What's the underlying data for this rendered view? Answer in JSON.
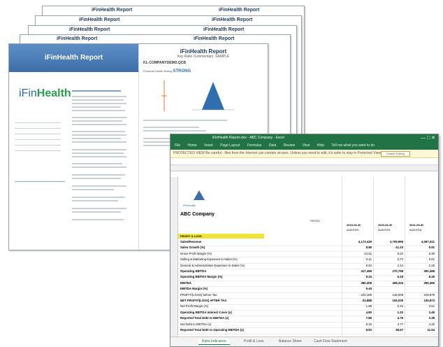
{
  "report": {
    "header_title": "iFinHealth Report",
    "cover_title": "iFinHealth Report",
    "logo": {
      "prefix": "iFin",
      "suffix": "Health"
    },
    "page_title": "iFinHealth Report",
    "page_subtitle": "Key Ratio Commentary: SAMPLE",
    "company_code": "KL-COMPANYDEMO.QCB",
    "score_label": "Financial Health Rating",
    "score_value": "STRONG",
    "colors": {
      "band": "#4f80ba",
      "accent": "#2f6fb0",
      "logo_green": "#2a9d4e"
    }
  },
  "excel": {
    "title": "iFinHealth Report.xlsx  -  ABC Company  -  Excel",
    "ribbon": [
      "File",
      "Home",
      "Insert",
      "Page Layout",
      "Formulas",
      "Data",
      "Review",
      "View",
      "Help",
      "Tell me what you want to do"
    ],
    "protected_view": "PROTECTED VIEW  Be careful - files from the Internet can contain viruses. Unless you need to edit, it's safer to stay in Protected View.",
    "enable_editing": "Enable Editing",
    "company": "ABC Company",
    "units": "RM'000",
    "columns": [
      "2019-06-30",
      "2020-06-30",
      "2021-06-30"
    ],
    "column_sub": [
      "AUDITED",
      "AUDITED",
      "AUDITED"
    ],
    "section": "PROFIT & LOSS",
    "rows": [
      {
        "label": "Sales/Revenue",
        "v": [
          "4,173,429",
          "3,709,996",
          "4,097,021"
        ]
      },
      {
        "label": "Sales Growth (%)",
        "v": [
          "8.86",
          "-11.10",
          "5.91"
        ]
      },
      {
        "label": "Gross Profit Margin (%)",
        "v": [
          "24.51",
          "8.22",
          "6.30"
        ]
      },
      {
        "label": "Selling & Marketing Expenses to Sales (%)",
        "v": [
          "0.11",
          "0.72",
          "0.01"
        ]
      },
      {
        "label": "General & Administrative Expenses to Sales (%)",
        "v": [
          "8.84",
          "2.44",
          "2.26"
        ]
      },
      {
        "label": "Operating EBITDA",
        "v": [
          "417,496",
          "270,798",
          "392,498"
        ]
      },
      {
        "label": "Operating EBITDA Margin (%)",
        "v": [
          "9.15",
          "6.18",
          "8.45"
        ]
      },
      {
        "label": "EBITDA",
        "v": [
          "380,408",
          "408,334",
          "390,455"
        ]
      },
      {
        "label": "EBITDA Margin (%)",
        "v": [
          "9.40",
          "",
          ""
        ]
      },
      {
        "label": "PROFIT/(LOSS) before Tax",
        "v": [
          "220,189",
          "148,009",
          "229,879"
        ]
      },
      {
        "label": "NET PROFIT/(LOSS) AFTER TAX",
        "v": [
          "-33,888",
          "109,039",
          "125,873"
        ]
      },
      {
        "label": "Net Profit Margin (%)",
        "v": [
          "1.88",
          "0.42",
          "3.61"
        ]
      },
      {
        "label": "Operating EBITDA Interest Cover (x)",
        "v": [
          "4.80",
          "1.20",
          "3.46"
        ]
      },
      {
        "label": "Reported Total Debt to EBITDA (x)",
        "v": [
          "7.86",
          "4.75",
          "3.38"
        ]
      },
      {
        "label": "Net Debt to EBITDA (x)",
        "v": [
          "8.16",
          "3.77",
          "4.20"
        ]
      },
      {
        "label": "Reported Total Debt to Operating EBITDA (x)",
        "v": [
          "8.83",
          "38.57",
          "11.54"
        ]
      }
    ],
    "tabs": [
      "Ratio Indicators",
      "Profit & Loss",
      "Balance Sheet",
      "Cash Flow Statement"
    ]
  }
}
